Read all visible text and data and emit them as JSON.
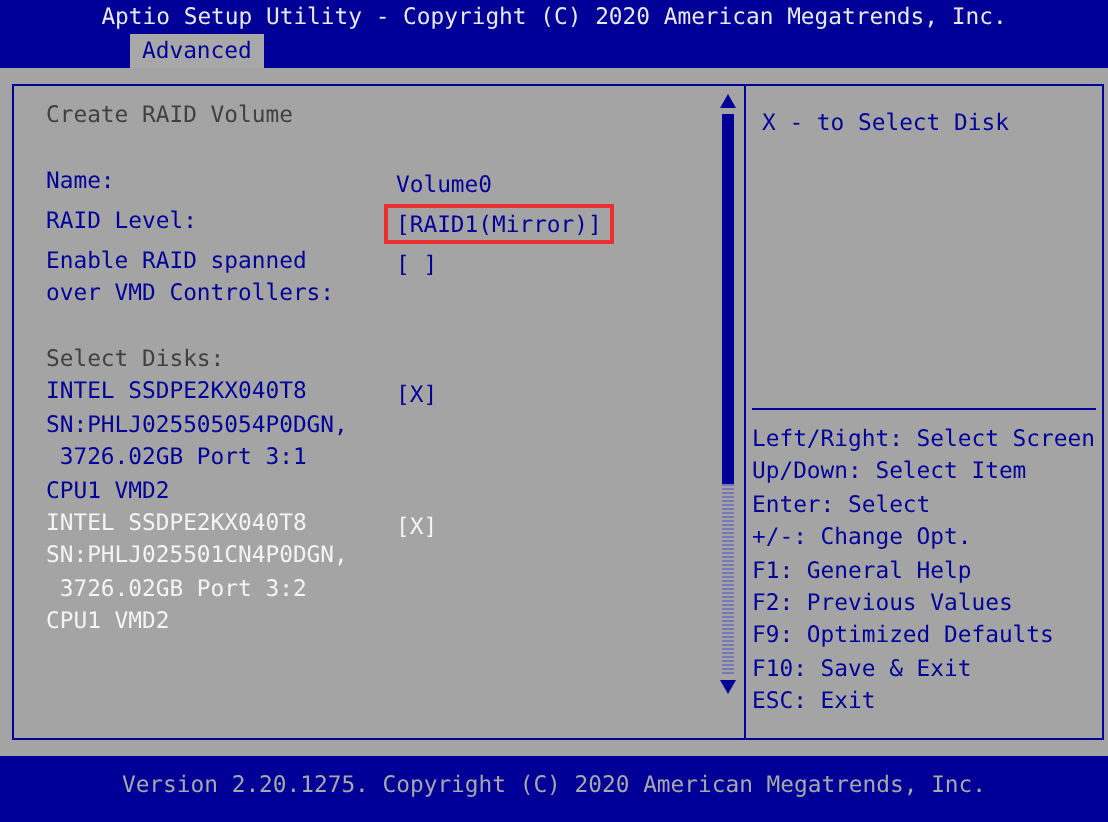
{
  "window": {
    "title": "Aptio Setup Utility - Copyright (C) 2020 American Megatrends, Inc."
  },
  "tabs": [
    {
      "label": "Advanced",
      "selected": true
    }
  ],
  "items": [
    {
      "kind": "title",
      "text": "Create RAID Volume"
    },
    {
      "kind": "option",
      "label_lines": [
        "Name:"
      ],
      "value": "Volume0",
      "selected": false,
      "marked": false
    },
    {
      "kind": "option",
      "label_lines": [
        "RAID Level:"
      ],
      "value": "[RAID1(Mirror)]",
      "selected": false,
      "marked": true
    },
    {
      "kind": "option",
      "label_lines": [
        "Enable RAID spanned",
        "over VMD Controllers:"
      ],
      "value": "[ ]",
      "selected": false,
      "marked": false
    },
    {
      "kind": "heading",
      "text": "Select Disks:"
    },
    {
      "kind": "option",
      "label_lines": [
        "INTEL SSDPE2KX040T8",
        "SN:PHLJ025505054P0DGN,",
        " 3726.02GB Port 3:1",
        "CPU1 VMD2"
      ],
      "value": "[X]",
      "selected": false,
      "marked": false
    },
    {
      "kind": "option",
      "label_lines": [
        "INTEL SSDPE2KX040T8",
        "SN:PHLJ025501CN4P0DGN,",
        " 3726.02GB Port 3:2",
        "CPU1 VMD2"
      ],
      "value": "[X]",
      "selected": true,
      "marked": false
    }
  ],
  "help": {
    "text": "X - to Select Disk"
  },
  "keys": [
    "Left/Right: Select Screen",
    "Up/Down: Select Item",
    "Enter: Select",
    "+/-: Change Opt.",
    "F1: General Help",
    "F2: Previous Values",
    "F9: Optimized Defaults",
    "F10: Save & Exit",
    "ESC: Exit"
  ],
  "footer": {
    "text": "Version 2.20.1275. Copyright (C) 2020 American Megatrends, Inc."
  }
}
